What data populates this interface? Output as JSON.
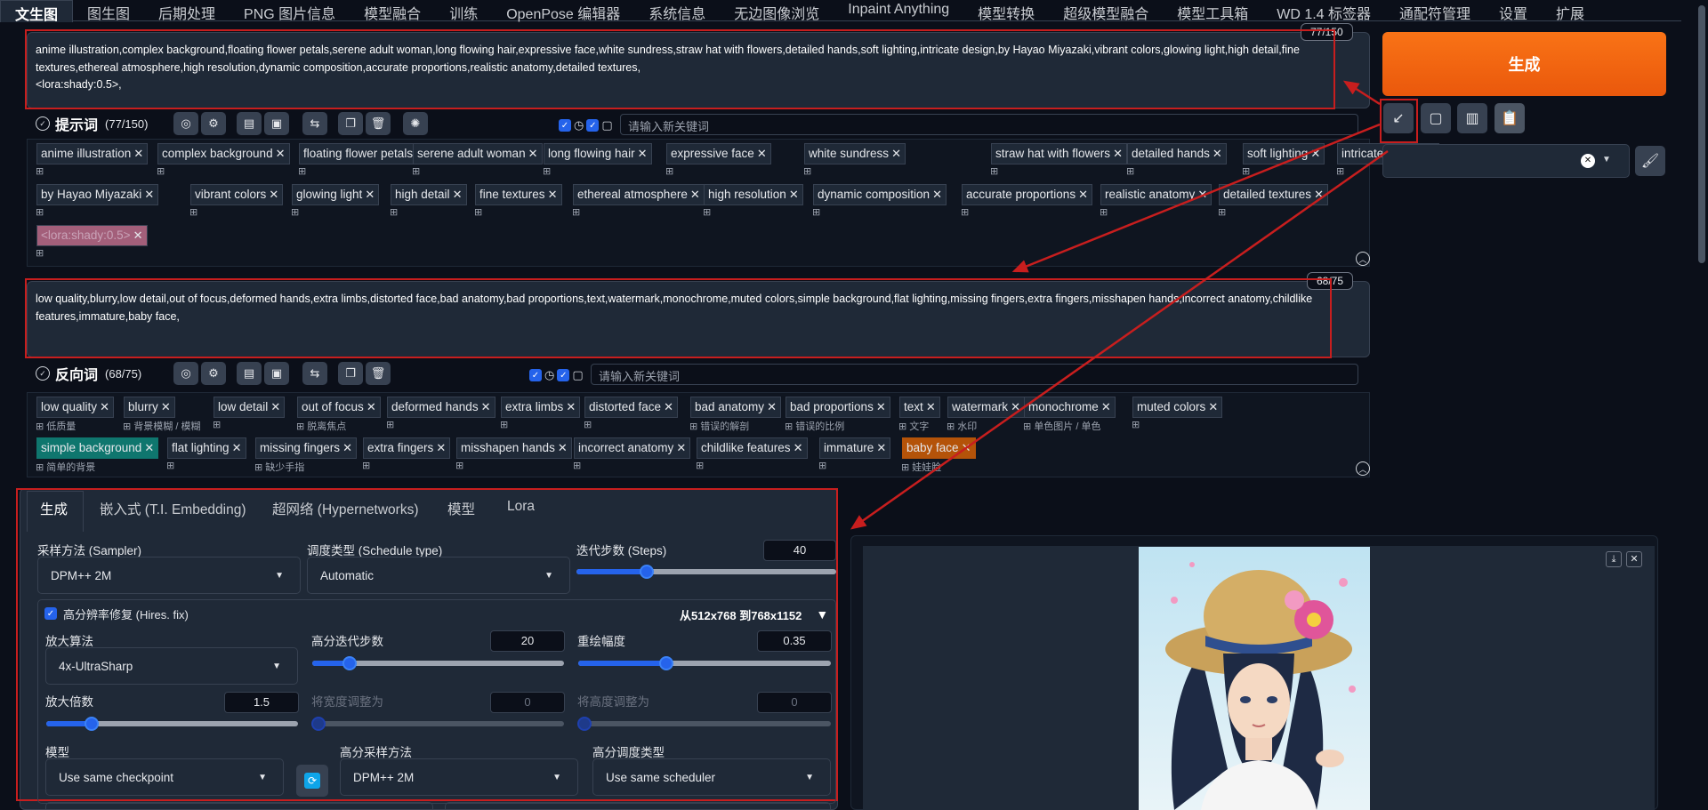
{
  "tabs": [
    "文生图",
    "图生图",
    "后期处理",
    "PNG 图片信息",
    "模型融合",
    "训练",
    "OpenPose 编辑器",
    "系统信息",
    "无边图像浏览",
    "Inpaint Anything",
    "模型转换",
    "超级模型融合",
    "模型工具箱",
    "WD 1.4 标签器",
    "通配符管理",
    "设置",
    "扩展"
  ],
  "positive": {
    "text": "anime illustration,complex background,floating flower petals,serene adult woman,long flowing hair,expressive face,white sundress,straw hat with flowers,detailed hands,soft lighting,intricate design,by Hayao Miyazaki,vibrant colors,glowing light,high detail,fine textures,ethereal atmosphere,high resolution,dynamic composition,accurate proportions,realistic anatomy,detailed textures,\n<lora:shady:0.5>,",
    "counter": "77/150",
    "label": "提示词",
    "count": "(77/150)",
    "kw_placeholder": "请输入新关键词",
    "tags": [
      "anime illustration",
      "complex background",
      "floating flower petals",
      "serene adult woman",
      "long flowing hair",
      "expressive face",
      "white sundress",
      "straw hat with flowers",
      "detailed hands",
      "soft lighting",
      "intricate design",
      "by Hayao Miyazaki",
      "vibrant colors",
      "glowing light",
      "high detail",
      "fine textures",
      "ethereal atmosphere",
      "high resolution",
      "dynamic composition",
      "accurate proportions",
      "realistic anatomy",
      "detailed textures",
      "<lora:shady:0.5>"
    ]
  },
  "negative": {
    "text": "low quality,blurry,low detail,out of focus,deformed hands,extra limbs,distorted face,bad anatomy,bad proportions,text,watermark,monochrome,muted colors,simple background,flat lighting,missing fingers,extra fingers,misshapen hands,incorrect anatomy,childlike features,immature,baby face,",
    "counter": "68/75",
    "label": "反向词",
    "count": "(68/75)",
    "kw_placeholder": "请输入新关键词",
    "tags": [
      "low quality",
      "blurry",
      "low detail",
      "out of focus",
      "deformed hands",
      "extra limbs",
      "distorted face",
      "bad anatomy",
      "bad proportions",
      "text",
      "watermark",
      "monochrome",
      "muted colors",
      "simple background",
      "flat lighting",
      "missing fingers",
      "extra fingers",
      "misshapen hands",
      "incorrect anatomy",
      "childlike features",
      "immature",
      "baby face"
    ],
    "subs": [
      "低质量",
      "背景模糊 / 模糊",
      "脱离焦点",
      "错误的解剖",
      "错误的比例",
      "文字",
      "水印",
      "单色图片 / 单色",
      "简单的背景",
      "缺少手指",
      "娃娃脸"
    ]
  },
  "generate_label": "生成",
  "subtabs": [
    "生成",
    "嵌入式 (T.I. Embedding)",
    "超网络 (Hypernetworks)",
    "模型",
    "Lora"
  ],
  "params": {
    "sampler_label": "采样方法 (Sampler)",
    "sampler": "DPM++ 2M",
    "schedule_label": "调度类型 (Schedule type)",
    "schedule": "Automatic",
    "steps_label": "迭代步数 (Steps)",
    "steps": "40",
    "hires_label": "高分辨率修复 (Hires. fix)",
    "hires_info": "从512x768 到768x1152",
    "upscaler_label": "放大算法",
    "upscaler": "4x-UltraSharp",
    "hires_steps_label": "高分迭代步数",
    "hires_steps": "20",
    "denoise_label": "重绘幅度",
    "denoise": "0.35",
    "scale_label": "放大倍数",
    "scale": "1.5",
    "width_label": "将宽度调整为",
    "width": "0",
    "height_label": "将高度调整为",
    "height": "0",
    "model_label": "模型",
    "model": "Use same checkpoint",
    "hires_sampler_label": "高分采样方法",
    "hires_sampler": "DPM++ 2M",
    "hires_sched_label": "高分调度类型",
    "hires_sched": "Use same scheduler"
  },
  "sliders": {
    "steps": 0.27,
    "hires_steps": 0.15,
    "denoise": 0.35,
    "scale": 0.18,
    "width": 0.0,
    "height": 0.0
  }
}
